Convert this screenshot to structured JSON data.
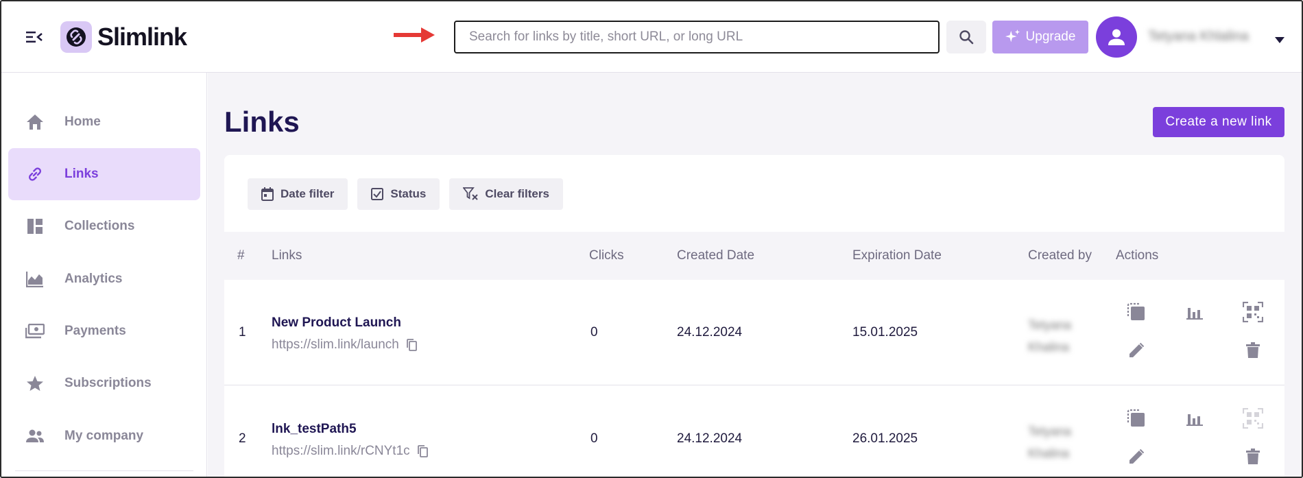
{
  "brand": {
    "name": "Slimlink",
    "accent": "#7b3fdc"
  },
  "header": {
    "search_placeholder": "Search for links by title, short URL, or long URL",
    "search_value": "",
    "upgrade_label": "Upgrade",
    "user_name": "Tetyana Khlalina"
  },
  "sidebar": {
    "items": [
      {
        "label": "Home",
        "icon": "home-icon",
        "active": false
      },
      {
        "label": "Links",
        "icon": "link-icon",
        "active": true
      },
      {
        "label": "Collections",
        "icon": "dashboard-icon",
        "active": false
      },
      {
        "label": "Analytics",
        "icon": "analytics-icon",
        "active": false
      },
      {
        "label": "Payments",
        "icon": "payments-icon",
        "active": false
      },
      {
        "label": "Subscriptions",
        "icon": "star-icon",
        "active": false
      },
      {
        "label": "My company",
        "icon": "people-icon",
        "active": false
      }
    ]
  },
  "main": {
    "title": "Links",
    "create_label": "Create a new link",
    "filters": [
      {
        "label": "Date filter",
        "icon": "calendar-icon"
      },
      {
        "label": "Status",
        "icon": "checkbox-icon"
      },
      {
        "label": "Clear filters",
        "icon": "filter-clear-icon"
      }
    ],
    "table": {
      "headers": [
        "#",
        "Links",
        "Clicks",
        "Created Date",
        "Expiration Date",
        "Created by",
        "Actions"
      ],
      "rows": [
        {
          "num": "1",
          "title": "New Product Launch",
          "short_url": "https://slim.link/launch",
          "clicks": "0",
          "created": "24.12.2024",
          "expires": "15.01.2025",
          "creator_first": "Tetyana",
          "creator_last": "Khalina"
        },
        {
          "num": "2",
          "title": "lnk_testPath5",
          "short_url": "https://slim.link/rCNYt1c",
          "clicks": "0",
          "created": "24.12.2024",
          "expires": "26.01.2025",
          "creator_first": "Tetyana",
          "creator_last": "Khalina"
        }
      ]
    }
  }
}
